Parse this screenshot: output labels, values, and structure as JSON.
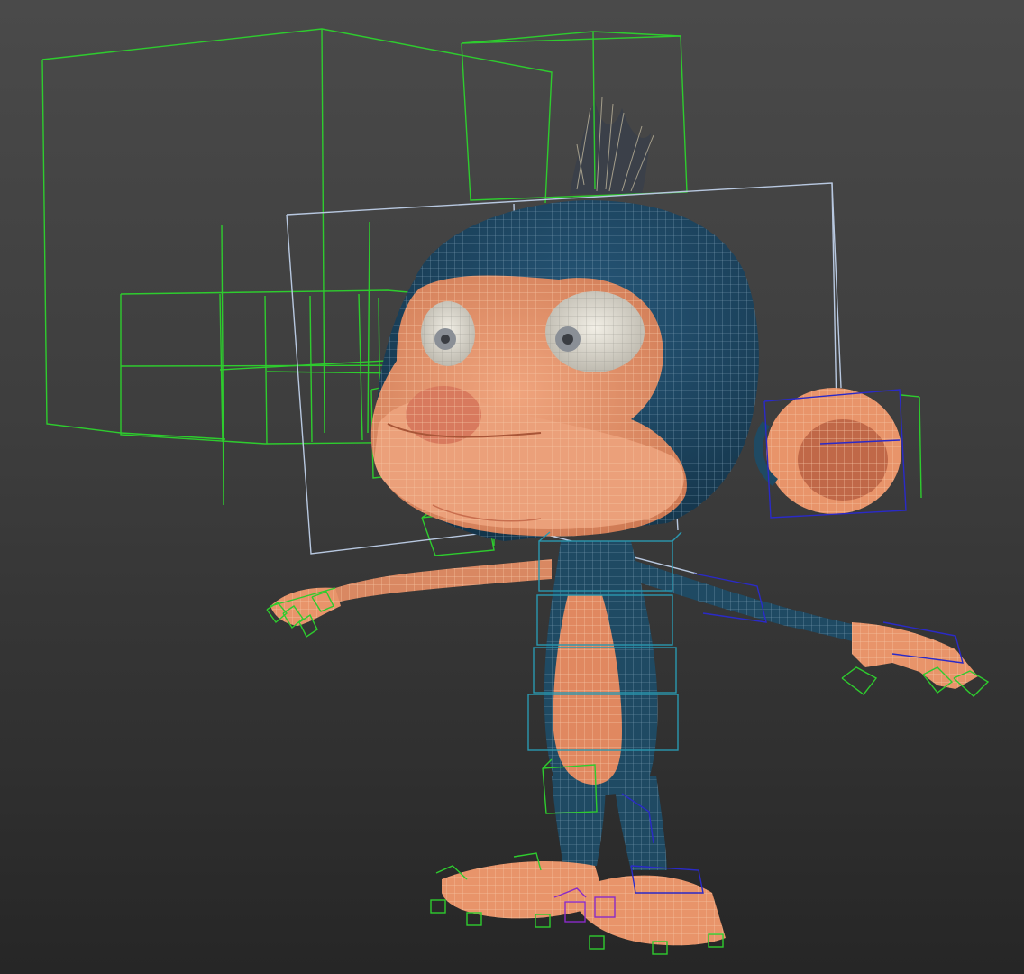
{
  "viewport": {
    "name": "perspective-viewport",
    "shading": "wireframe-over-shaded",
    "subject": "cartoon-monkey"
  },
  "colors": {
    "background_top": "#4a4a4a",
    "background_bottom": "#262626",
    "skin": "#e8946a",
    "skin_shadow": "#c9704c",
    "fur": "#1f4a63",
    "fur_shadow": "#16384d",
    "wire_skin": "#f2b48e",
    "wire_fur": "#6a8aa0",
    "eye_white": "#dedad0",
    "iris": "#8a8f96",
    "bone_green": "#2ecc2e",
    "bone_cyan": "#2a98b0",
    "bone_blue": "#2a2ac8",
    "bone_purple": "#8a2ac8",
    "bbox_lightblue": "#b8c8e0",
    "hair": "#a8a090"
  },
  "objects": [
    {
      "name": "head-mesh"
    },
    {
      "name": "body-mesh"
    },
    {
      "name": "eye-left"
    },
    {
      "name": "eye-right"
    },
    {
      "name": "ear-right"
    },
    {
      "name": "hair-tuft"
    },
    {
      "name": "facial-rig-controls"
    },
    {
      "name": "spine-bones"
    },
    {
      "name": "left-hand-controls"
    },
    {
      "name": "right-hand-controls"
    },
    {
      "name": "foot-controls"
    }
  ]
}
